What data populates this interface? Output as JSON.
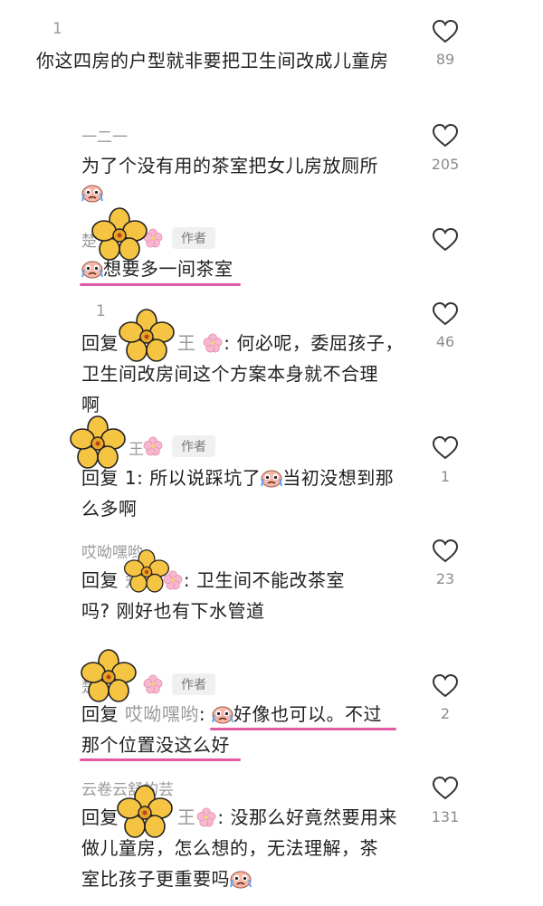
{
  "comments": [
    {
      "user": "1",
      "text": "你这四房的户型就非要把卫生间改成儿童房",
      "likes": "89"
    },
    {
      "user": "一二一",
      "text": "为了个没有用的茶室把女儿房放厕所",
      "likes": "205"
    },
    {
      "user": "楚",
      "badge": "作者",
      "text": "想要多一间茶室",
      "likes": ""
    },
    {
      "user": "1",
      "reply": "回复",
      "reply_to": "王",
      "text_parts": [
        ": 何必呢，委屈孩子，",
        "卫生间改房间这个方案本身就不合理",
        "啊"
      ],
      "likes": "46"
    },
    {
      "user": "王",
      "badge": "作者",
      "reply": "回复",
      "reply_to": "1",
      "text_parts": [
        ": 所以说踩坑了",
        "当初没想到那",
        "么多啊"
      ],
      "likes": "1"
    },
    {
      "user": "哎呦嘿哟",
      "reply": "回复",
      "reply_to": "楚王",
      "text_parts": [
        ": 卫生间不能改茶室",
        "吗? 刚好也有下水管道"
      ],
      "likes": "23"
    },
    {
      "user": "楚",
      "badge": "作者",
      "reply": "回复",
      "reply_to": "哎呦嘿哟",
      "text_parts": [
        ":",
        "好像也可以。不过",
        "那个位置没这么好"
      ],
      "likes": "2"
    },
    {
      "user": "云卷云舒的芸",
      "reply": "回复",
      "reply_to": "王",
      "text_parts": [
        ": 没那么好竟然要用来",
        "做儿童房，怎么想的，无法理解，茶",
        "室比孩子更重要吗"
      ],
      "likes": "131"
    }
  ],
  "colors": {
    "highlight": "#e05aa4",
    "meta": "#9a9a9a",
    "text": "#1f1f1f"
  },
  "icons": [
    "heart-outline-icon",
    "crying-emoji-icon",
    "flower-sticker-icon",
    "cherry-blossom-icon"
  ]
}
